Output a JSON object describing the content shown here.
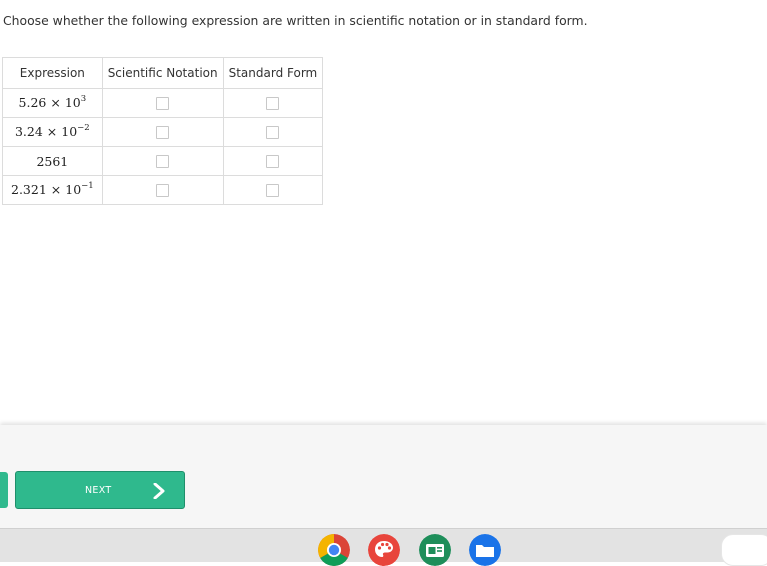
{
  "question": {
    "prompt": "Choose whether the following expression are written in scientific notation or in standard form."
  },
  "table": {
    "headers": [
      "Expression",
      "Scientific Notation",
      "Standard Form"
    ],
    "rows": [
      {
        "base": "5.26",
        "times": "×",
        "power_base": "10",
        "exponent": "3",
        "plain": ""
      },
      {
        "base": "3.24",
        "times": "×",
        "power_base": "10",
        "exponent": "−2",
        "plain": ""
      },
      {
        "base": "",
        "times": "",
        "power_base": "",
        "exponent": "",
        "plain": "2561"
      },
      {
        "base": "2.321",
        "times": "×",
        "power_base": "10",
        "exponent": "−1",
        "plain": ""
      }
    ],
    "checked": {
      "scientific": [
        false,
        false,
        false,
        false
      ],
      "standard": [
        false,
        false,
        false,
        false
      ]
    }
  },
  "footer": {
    "next_label": "NEXT",
    "accent_color": "#2fb98d"
  },
  "taskbar": {
    "apps": [
      "chrome-icon",
      "palette-icon",
      "classroom-icon",
      "files-icon"
    ]
  }
}
